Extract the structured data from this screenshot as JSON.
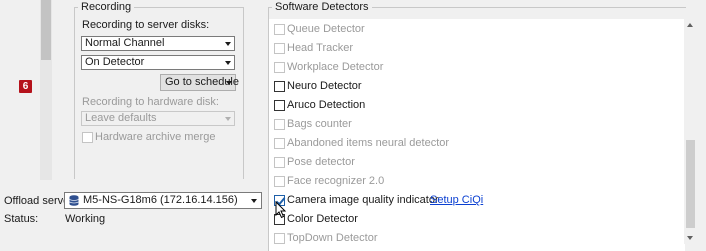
{
  "left": {
    "badge": "6"
  },
  "recording": {
    "title": "Recording",
    "server_disks_label": "Recording to server disks:",
    "channel_select": "Normal Channel",
    "detector_select": "On Detector",
    "schedule_button": "Go to schedule",
    "hardware_disk_label": "Recording to hardware disk:",
    "hardware_select": "Leave defaults",
    "archive_merge_label": "Hardware archive merge",
    "archive_merge_checked": false
  },
  "offload": {
    "server_label": "Offload server:",
    "server_value": "M5-NS-G18m6 (172.16.14.156)",
    "server_icon": "database-icon",
    "status_label": "Status:",
    "status_value": "Working"
  },
  "software_detectors": {
    "title": "Software Detectors",
    "items": [
      {
        "label": "Queue Detector",
        "enabled": false,
        "checked": false
      },
      {
        "label": "Head Tracker",
        "enabled": false,
        "checked": false
      },
      {
        "label": "Workplace Detector",
        "enabled": false,
        "checked": false
      },
      {
        "label": "Neuro Detector",
        "enabled": true,
        "checked": false
      },
      {
        "label": "Aruco Detection",
        "enabled": true,
        "checked": false
      },
      {
        "label": "Bags counter",
        "enabled": false,
        "checked": false
      },
      {
        "label": "Abandoned items neural detector",
        "enabled": false,
        "checked": false
      },
      {
        "label": "Pose detector",
        "enabled": false,
        "checked": false
      },
      {
        "label": "Face recognizer 2.0",
        "enabled": false,
        "checked": false
      },
      {
        "label": "Camera image quality indicator",
        "enabled": true,
        "checked": true
      },
      {
        "label": "Color Detector",
        "enabled": true,
        "checked": false
      },
      {
        "label": "TopDown Detector",
        "enabled": false,
        "checked": false
      }
    ],
    "setup_link": "Setup CiQi"
  },
  "colors": {
    "badge": "#b5121b",
    "link": "#0a3fd1",
    "checkbox_accent": "#1e5fa8"
  }
}
